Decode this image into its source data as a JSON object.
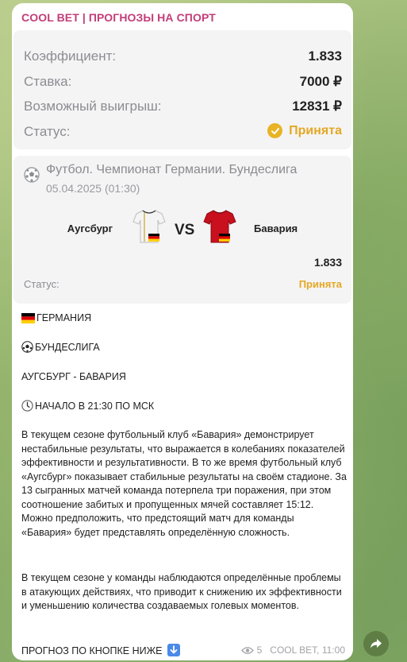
{
  "channel": {
    "title": "COOL BET | ПРОГНОЗЫ НА СПОРТ"
  },
  "bet": {
    "coef_label": "Коэффициент:",
    "coef_value": "1.833",
    "stake_label": "Ставка:",
    "stake_value": "7000 ₽",
    "win_label": "Возможный выигрыш:",
    "win_value": "12831 ₽",
    "status_label": "Статус:",
    "status_value": "Принята"
  },
  "match": {
    "league": "Футбол. Чемпионат Германии. Бундеслига",
    "date": "05.04.2025 (01:30)",
    "team1": "Аугсбург",
    "vs": "VS",
    "team2": "Бавария",
    "odds": "1.833",
    "status_label": "Статус:",
    "status_value": "Принята"
  },
  "post": {
    "country": "ГЕРМАНИЯ",
    "league": "БУНДЕСЛИГА",
    "teams": "АУГСБУРГ - БАВАРИЯ",
    "start": "НАЧАЛО В 21:30 ПО МСК",
    "para1": "В текущем сезоне футбольный клуб «Бавария» демонстрирует нестабильные результаты, что выражается в колебаниях показателей эффективности и результативности. В то же время футбольный клуб «Аугсбург» показывает стабильные результаты на своём стадионе. За 13 сыгранных матчей команда потерпела три поражения, при этом соотношение забитых и пропущенных мячей составляет 15:12. Можно предположить, что предстоящий матч для команды «Бавария» будет представлять определённую сложность.",
    "para2": "В текущем сезоне у команды наблюдаются определённые проблемы в атакующих действиях, что приводит к снижению их эффективности и уменьшению количества создаваемых голевых моментов.",
    "footer": "ПРОГНОЗ ПО КНОПКЕ НИЖЕ"
  },
  "meta": {
    "views": "5",
    "author_time": "COOL BET, 11:00"
  },
  "colors": {
    "accent": "#c33d77",
    "status": "#e5a823"
  },
  "icons": [
    "check-icon",
    "soccer-ball-icon",
    "germany-flag-icon",
    "clock-icon",
    "down-arrow-icon",
    "eye-icon",
    "share-icon"
  ]
}
